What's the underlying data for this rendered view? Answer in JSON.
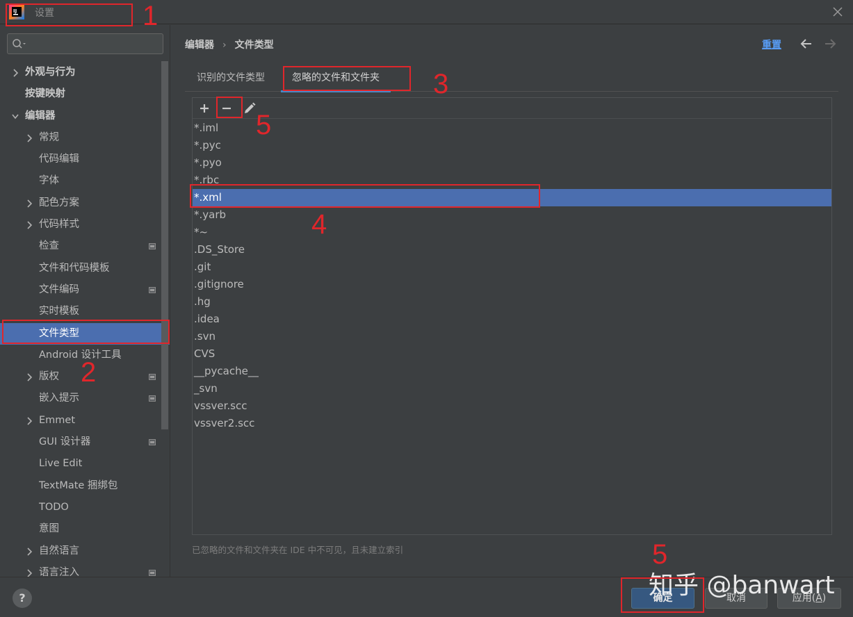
{
  "window": {
    "title": "设置"
  },
  "search": {
    "placeholder": ""
  },
  "sidebar": {
    "items": [
      {
        "label": "外观与行为",
        "level": 0,
        "arrow": "right"
      },
      {
        "label": "按键映射",
        "level": 0,
        "arrow": ""
      },
      {
        "label": "编辑器",
        "level": 0,
        "arrow": "down"
      },
      {
        "label": "常规",
        "level": 1,
        "arrow": "right"
      },
      {
        "label": "代码编辑",
        "level": 1,
        "arrow": ""
      },
      {
        "label": "字体",
        "level": 1,
        "arrow": ""
      },
      {
        "label": "配色方案",
        "level": 1,
        "arrow": "right"
      },
      {
        "label": "代码样式",
        "level": 1,
        "arrow": "right"
      },
      {
        "label": "检查",
        "level": 1,
        "arrow": "",
        "badge": true
      },
      {
        "label": "文件和代码模板",
        "level": 1,
        "arrow": ""
      },
      {
        "label": "文件编码",
        "level": 1,
        "arrow": "",
        "badge": true
      },
      {
        "label": "实时模板",
        "level": 1,
        "arrow": ""
      },
      {
        "label": "文件类型",
        "level": 1,
        "arrow": "",
        "selected": true
      },
      {
        "label": "Android 设计工具",
        "level": 1,
        "arrow": ""
      },
      {
        "label": "版权",
        "level": 1,
        "arrow": "right",
        "badge": true
      },
      {
        "label": "嵌入提示",
        "level": 1,
        "arrow": "",
        "badge": true
      },
      {
        "label": "Emmet",
        "level": 1,
        "arrow": "right"
      },
      {
        "label": "GUI 设计器",
        "level": 1,
        "arrow": "",
        "badge": true
      },
      {
        "label": "Live Edit",
        "level": 1,
        "arrow": ""
      },
      {
        "label": "TextMate 捆绑包",
        "level": 1,
        "arrow": ""
      },
      {
        "label": "TODO",
        "level": 1,
        "arrow": ""
      },
      {
        "label": "意图",
        "level": 1,
        "arrow": ""
      },
      {
        "label": "自然语言",
        "level": 1,
        "arrow": "right"
      },
      {
        "label": "语言注入",
        "level": 1,
        "arrow": "right",
        "badge": true
      }
    ]
  },
  "breadcrumb": {
    "parent": "编辑器",
    "separator": "›",
    "current": "文件类型"
  },
  "header": {
    "reset_label": "重置"
  },
  "tabs": [
    {
      "label": "识别的文件类型",
      "active": false
    },
    {
      "label": "忽略的文件和文件夹",
      "active": true
    }
  ],
  "ignored_list": {
    "items": [
      "*.iml",
      "*.pyc",
      "*.pyo",
      "*.rbc",
      "*.xml",
      "*.yarb",
      "*~",
      ".DS_Store",
      ".git",
      ".gitignore",
      ".hg",
      ".idea",
      ".svn",
      "CVS",
      "__pycache__",
      "_svn",
      "vssver.scc",
      "vssver2.scc"
    ],
    "selected_index": 4
  },
  "hint": "已忽略的文件和文件夹在 IDE 中不可见，且未建立索引",
  "footer": {
    "help_label": "?",
    "ok_label": "确定",
    "cancel_label": "取消",
    "apply_label": "应用(",
    "apply_mnemonic": "A",
    "apply_suffix": ")"
  },
  "annotations": [
    "1",
    "2",
    "3",
    "4",
    "5",
    "5"
  ],
  "watermark": "知乎 @banwart",
  "colors": {
    "background": "#3c3f41",
    "selection": "#4b6eaf",
    "accent_link": "#589df6",
    "annotation_red": "#e0262b",
    "ok_button": "#365880"
  }
}
